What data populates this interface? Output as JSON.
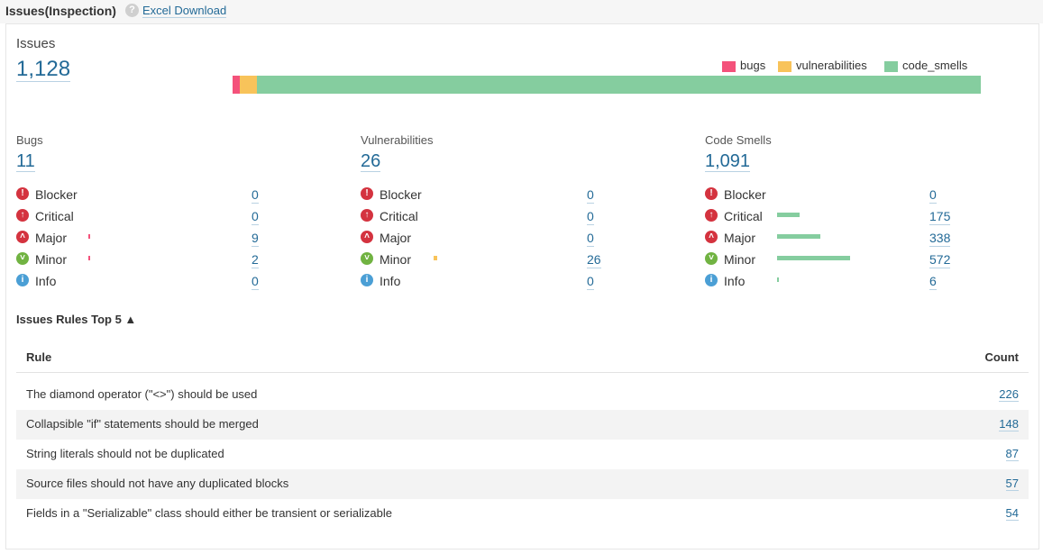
{
  "header": {
    "title": "Issues(Inspection)",
    "help_icon": "question-icon",
    "excel_link": "Excel Download"
  },
  "summary": {
    "label": "Issues",
    "total": "1,128",
    "legend": [
      {
        "name": "bugs",
        "color": "#f4527b"
      },
      {
        "name": "vulnerabilities",
        "color": "#f8c35a"
      },
      {
        "name": "code_smells",
        "color": "#85cd9f"
      }
    ],
    "stack": {
      "bugs": 11,
      "vulnerabilities": 26,
      "code_smells": 1091,
      "total": 1128
    }
  },
  "colors": {
    "link": "#236a97",
    "bug": "#f4527b",
    "vulnerability": "#f8c35a",
    "smell": "#85cd9f",
    "blocker": "#d4333f",
    "critical": "#d4333f",
    "major": "#d4333f",
    "minor": "#71b342",
    "info": "#4b9fd5"
  },
  "severity_icons": {
    "Blocker": "exclamation-circle-icon",
    "Critical": "double-up-arrow-circle-icon",
    "Major": "up-chevron-circle-icon",
    "Minor": "down-chevron-circle-icon",
    "Info": "info-circle-icon"
  },
  "columns": [
    {
      "title": "Bugs",
      "count": "11",
      "bar_color": "#f4527b",
      "rows": [
        {
          "severity": "Blocker",
          "value": 0
        },
        {
          "severity": "Critical",
          "value": 0
        },
        {
          "severity": "Major",
          "value": 9
        },
        {
          "severity": "Minor",
          "value": 2
        },
        {
          "severity": "Info",
          "value": 0
        }
      ]
    },
    {
      "title": "Vulnerabilities",
      "count": "26",
      "bar_color": "#f8c35a",
      "rows": [
        {
          "severity": "Blocker",
          "value": 0
        },
        {
          "severity": "Critical",
          "value": 0
        },
        {
          "severity": "Major",
          "value": 0
        },
        {
          "severity": "Minor",
          "value": 26
        },
        {
          "severity": "Info",
          "value": 0
        }
      ]
    },
    {
      "title": "Code Smells",
      "count": "1,091",
      "bar_color": "#85cd9f",
      "rows": [
        {
          "severity": "Blocker",
          "value": 0
        },
        {
          "severity": "Critical",
          "value": 175
        },
        {
          "severity": "Major",
          "value": 338
        },
        {
          "severity": "Minor",
          "value": 572
        },
        {
          "severity": "Info",
          "value": 6
        }
      ]
    }
  ],
  "top_rules": {
    "title": "Issues Rules Top 5 ▲",
    "col_rule": "Rule",
    "col_count": "Count",
    "rows": [
      {
        "rule": "The diamond operator (\"<>\") should be used",
        "count": "226"
      },
      {
        "rule": "Collapsible \"if\" statements should be merged",
        "count": "148"
      },
      {
        "rule": "String literals should not be duplicated",
        "count": "87"
      },
      {
        "rule": "Source files should not have any duplicated blocks",
        "count": "57"
      },
      {
        "rule": "Fields in a \"Serializable\" class should either be transient or serializable",
        "count": "54"
      }
    ]
  }
}
